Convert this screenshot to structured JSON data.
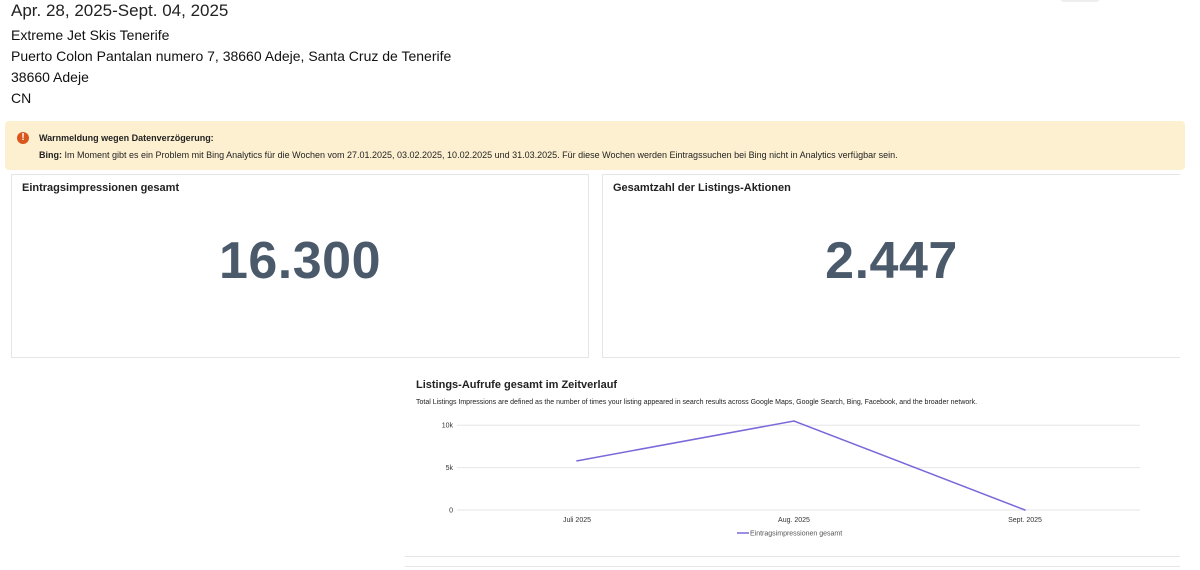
{
  "header": {
    "date_range": "Apr. 28, 2025-Sept. 04, 2025",
    "business_name": "Extreme Jet Skis Tenerife",
    "address": "Puerto Colon Pantalan numero 7, 38660 Adeje, Santa Cruz de Tenerife",
    "city_line": "38660 Adeje",
    "region": "CN"
  },
  "warning": {
    "icon": "error-icon",
    "title": "Warnmeldung wegen Datenverzögerung:",
    "source": "Bing:",
    "message": "Im Moment gibt es ein Problem mit Bing Analytics für die Wochen vom 27.01.2025, 03.02.2025, 10.02.2025 und 31.03.2025. Für diese Wochen werden Eintragssuchen bei Bing nicht in Analytics verfügbar sein.",
    "accent_color": "#d9571c",
    "background_color": "#fdf0d0"
  },
  "kpis": {
    "impressions": {
      "label": "Eintragsimpressionen gesamt",
      "value": "16.300"
    },
    "actions": {
      "label": "Gesamtzahl der Listings-Aktionen",
      "value": "2.447"
    }
  },
  "chart_data": {
    "type": "line",
    "title": "Listings-Aufrufe gesamt im Zeitverlauf",
    "subtitle": "Total Listings Impressions are defined as the number of times your listing appeared in search results across Google Maps, Google Search, Bing, Facebook, and the broader network.",
    "categories": [
      "Juli 2025",
      "Aug. 2025",
      "Sept. 2025"
    ],
    "series": [
      {
        "name": "Eintragsimpressionen gesamt",
        "values": [
          5800,
          10500,
          0
        ],
        "color": "#7b68d9"
      }
    ],
    "y_ticks": [
      "0",
      "5k",
      "10k"
    ],
    "y_tick_values": [
      0,
      5000,
      10000
    ],
    "ylim": [
      0,
      10500
    ],
    "grid": true,
    "legend": "bottom"
  }
}
